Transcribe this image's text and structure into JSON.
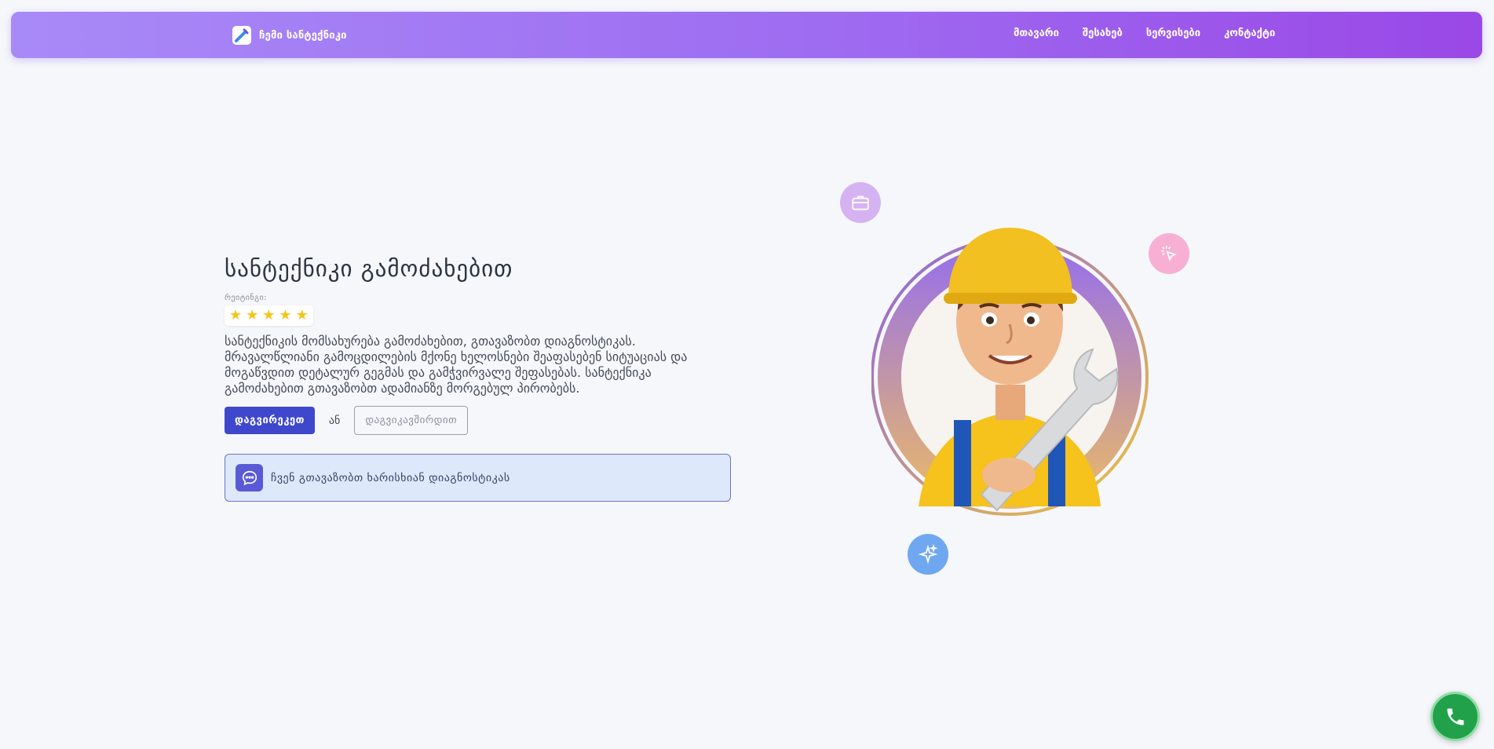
{
  "nav": {
    "brand": "ჩემი სანტექნიკი",
    "links": [
      "მთავარი",
      "შესახებ",
      "სერვისები",
      "კონტაქტი"
    ]
  },
  "hero": {
    "title": "სანტექნიკი გამოძახებით",
    "rating_label": "რეიტინგი:",
    "rating": 5,
    "description": "სანტექნიკის მომსახურება გამოძახებით, გთავაზობთ დიაგნოსტიკას. მრავალწლიანი გამოცდილების მქონე ხელოსნები შეაფასებენ სიტუაციას და მოგაწვდით დეტალურ გეგმას და გამჭვირვალე შეფასებას. სანტექნიკა გამოძახებით გთავაზობთ ადამიანზე მორგებულ პირობებს.",
    "primary_button": "დაგვირეკეთ",
    "or_text": "ან",
    "secondary_button": "დაგვიკავშირდით",
    "info_text": "ჩვენ გთავაზობთ ხარისხიან დიაგნოსტიკას"
  },
  "floating_icons": [
    "briefcase-icon",
    "cursor-click-icon",
    "sparkle-icon"
  ],
  "colors": {
    "nav_gradient_start": "#a88af7",
    "nav_gradient_end": "#9a48e6",
    "primary": "#3f48cc",
    "call_button": "#21a24a"
  }
}
